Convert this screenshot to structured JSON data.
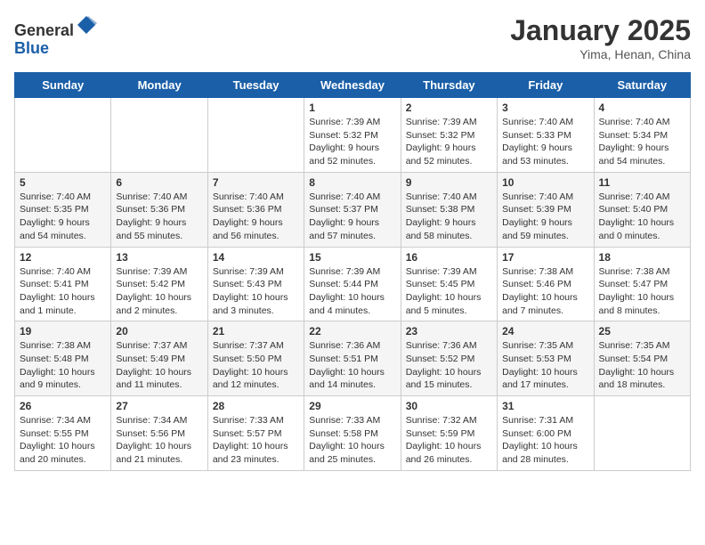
{
  "header": {
    "logo_line1": "General",
    "logo_line2": "Blue",
    "month": "January 2025",
    "location": "Yima, Henan, China"
  },
  "days_of_week": [
    "Sunday",
    "Monday",
    "Tuesday",
    "Wednesday",
    "Thursday",
    "Friday",
    "Saturday"
  ],
  "weeks": [
    [
      {
        "day": "",
        "info": ""
      },
      {
        "day": "",
        "info": ""
      },
      {
        "day": "",
        "info": ""
      },
      {
        "day": "1",
        "info": "Sunrise: 7:39 AM\nSunset: 5:32 PM\nDaylight: 9 hours and 52 minutes."
      },
      {
        "day": "2",
        "info": "Sunrise: 7:39 AM\nSunset: 5:32 PM\nDaylight: 9 hours and 52 minutes."
      },
      {
        "day": "3",
        "info": "Sunrise: 7:40 AM\nSunset: 5:33 PM\nDaylight: 9 hours and 53 minutes."
      },
      {
        "day": "4",
        "info": "Sunrise: 7:40 AM\nSunset: 5:34 PM\nDaylight: 9 hours and 54 minutes."
      }
    ],
    [
      {
        "day": "5",
        "info": "Sunrise: 7:40 AM\nSunset: 5:35 PM\nDaylight: 9 hours and 54 minutes."
      },
      {
        "day": "6",
        "info": "Sunrise: 7:40 AM\nSunset: 5:36 PM\nDaylight: 9 hours and 55 minutes."
      },
      {
        "day": "7",
        "info": "Sunrise: 7:40 AM\nSunset: 5:36 PM\nDaylight: 9 hours and 56 minutes."
      },
      {
        "day": "8",
        "info": "Sunrise: 7:40 AM\nSunset: 5:37 PM\nDaylight: 9 hours and 57 minutes."
      },
      {
        "day": "9",
        "info": "Sunrise: 7:40 AM\nSunset: 5:38 PM\nDaylight: 9 hours and 58 minutes."
      },
      {
        "day": "10",
        "info": "Sunrise: 7:40 AM\nSunset: 5:39 PM\nDaylight: 9 hours and 59 minutes."
      },
      {
        "day": "11",
        "info": "Sunrise: 7:40 AM\nSunset: 5:40 PM\nDaylight: 10 hours and 0 minutes."
      }
    ],
    [
      {
        "day": "12",
        "info": "Sunrise: 7:40 AM\nSunset: 5:41 PM\nDaylight: 10 hours and 1 minute."
      },
      {
        "day": "13",
        "info": "Sunrise: 7:39 AM\nSunset: 5:42 PM\nDaylight: 10 hours and 2 minutes."
      },
      {
        "day": "14",
        "info": "Sunrise: 7:39 AM\nSunset: 5:43 PM\nDaylight: 10 hours and 3 minutes."
      },
      {
        "day": "15",
        "info": "Sunrise: 7:39 AM\nSunset: 5:44 PM\nDaylight: 10 hours and 4 minutes."
      },
      {
        "day": "16",
        "info": "Sunrise: 7:39 AM\nSunset: 5:45 PM\nDaylight: 10 hours and 5 minutes."
      },
      {
        "day": "17",
        "info": "Sunrise: 7:38 AM\nSunset: 5:46 PM\nDaylight: 10 hours and 7 minutes."
      },
      {
        "day": "18",
        "info": "Sunrise: 7:38 AM\nSunset: 5:47 PM\nDaylight: 10 hours and 8 minutes."
      }
    ],
    [
      {
        "day": "19",
        "info": "Sunrise: 7:38 AM\nSunset: 5:48 PM\nDaylight: 10 hours and 9 minutes."
      },
      {
        "day": "20",
        "info": "Sunrise: 7:37 AM\nSunset: 5:49 PM\nDaylight: 10 hours and 11 minutes."
      },
      {
        "day": "21",
        "info": "Sunrise: 7:37 AM\nSunset: 5:50 PM\nDaylight: 10 hours and 12 minutes."
      },
      {
        "day": "22",
        "info": "Sunrise: 7:36 AM\nSunset: 5:51 PM\nDaylight: 10 hours and 14 minutes."
      },
      {
        "day": "23",
        "info": "Sunrise: 7:36 AM\nSunset: 5:52 PM\nDaylight: 10 hours and 15 minutes."
      },
      {
        "day": "24",
        "info": "Sunrise: 7:35 AM\nSunset: 5:53 PM\nDaylight: 10 hours and 17 minutes."
      },
      {
        "day": "25",
        "info": "Sunrise: 7:35 AM\nSunset: 5:54 PM\nDaylight: 10 hours and 18 minutes."
      }
    ],
    [
      {
        "day": "26",
        "info": "Sunrise: 7:34 AM\nSunset: 5:55 PM\nDaylight: 10 hours and 20 minutes."
      },
      {
        "day": "27",
        "info": "Sunrise: 7:34 AM\nSunset: 5:56 PM\nDaylight: 10 hours and 21 minutes."
      },
      {
        "day": "28",
        "info": "Sunrise: 7:33 AM\nSunset: 5:57 PM\nDaylight: 10 hours and 23 minutes."
      },
      {
        "day": "29",
        "info": "Sunrise: 7:33 AM\nSunset: 5:58 PM\nDaylight: 10 hours and 25 minutes."
      },
      {
        "day": "30",
        "info": "Sunrise: 7:32 AM\nSunset: 5:59 PM\nDaylight: 10 hours and 26 minutes."
      },
      {
        "day": "31",
        "info": "Sunrise: 7:31 AM\nSunset: 6:00 PM\nDaylight: 10 hours and 28 minutes."
      },
      {
        "day": "",
        "info": ""
      }
    ]
  ]
}
